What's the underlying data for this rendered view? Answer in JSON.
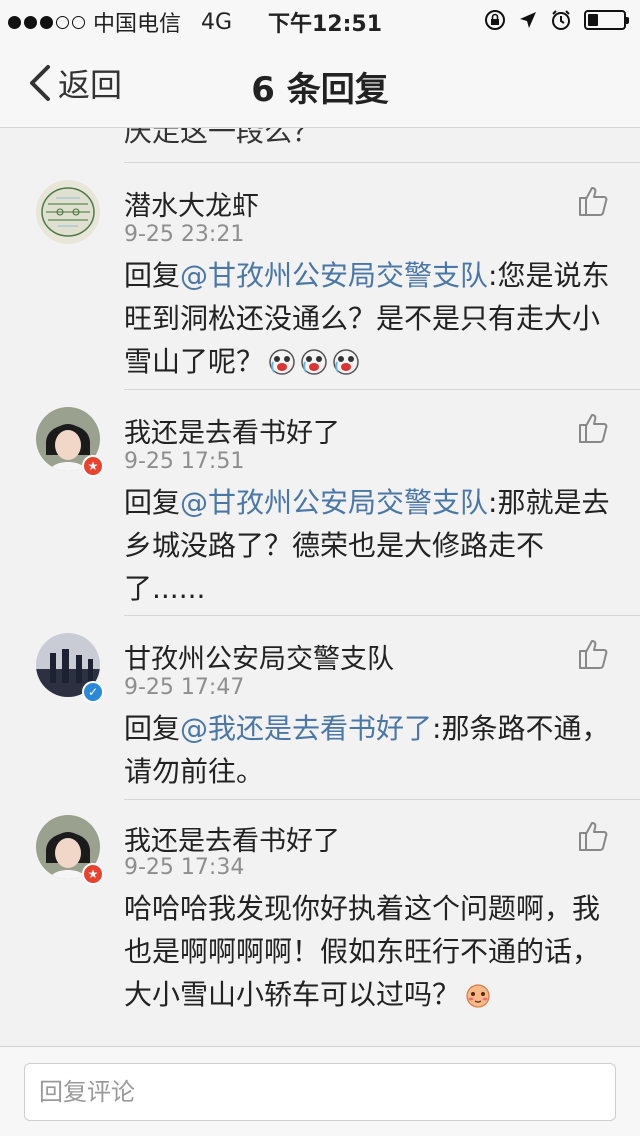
{
  "status_bar": {
    "carrier": "中国电信",
    "network": "4G",
    "time": "下午12:51",
    "signal_bars": 3,
    "battery_level": 0.3
  },
  "nav": {
    "back_label": "返回",
    "title": "6 条回复"
  },
  "partial_text": "庆走这一段么？",
  "comments": [
    {
      "name": "潜水大龙虾",
      "time": "9-25 23:21",
      "prefix": "回复",
      "mention": "@甘孜州公安局交警支队",
      "text": ":您是说东旺到洞松还没通么？是不是只有走大小雪山了呢？",
      "emoji": "laughing-tears-emoji"
    },
    {
      "name": "我还是去看书好了",
      "time": "9-25 17:51",
      "prefix": "回复",
      "mention": "@甘孜州公安局交警支队",
      "text": ":那就是去乡城没路了？德荣也是大修路走不了......"
    },
    {
      "name": "甘孜州公安局交警支队",
      "time": "9-25 17:47",
      "prefix": "回复",
      "mention": "@我还是去看书好了",
      "text": ":那条路不通，请勿前往。"
    },
    {
      "name": "我还是去看书好了",
      "time": "9-25 17:34",
      "text": "哈哈哈我发现你好执着这个问题啊，我也是啊啊啊啊！假如东旺行不通的话，大小雪山小轿车可以过吗？",
      "emoji": "blush-emoji"
    }
  ],
  "bottom": {
    "placeholder": "回复评论"
  },
  "colors": {
    "mention": "#4a77a8",
    "badge_red": "#e9432f",
    "badge_blue": "#2b8ad8"
  }
}
